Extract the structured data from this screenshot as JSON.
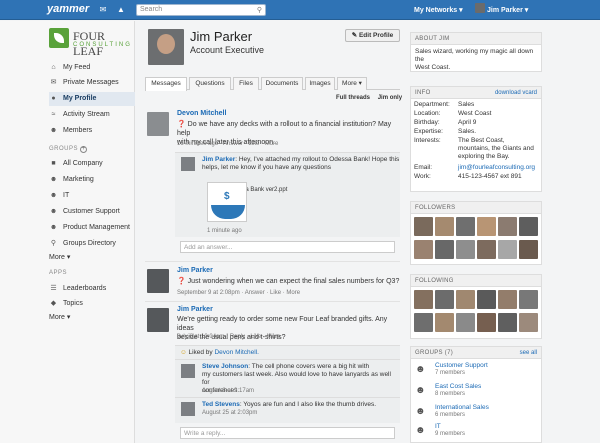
{
  "topbar": {
    "logo": "yammer",
    "search_placeholder": "Search",
    "networks_label": "My Networks ▾",
    "user_label": "Jim Parker ▾"
  },
  "brand": {
    "line1": "FOUR LEAF",
    "line2": "CONSULTING"
  },
  "nav": {
    "items": [
      {
        "label": "My Feed",
        "icon": "home-icon"
      },
      {
        "label": "Private Messages",
        "icon": "mail-icon"
      },
      {
        "label": "My Profile",
        "icon": "user-icon"
      },
      {
        "label": "Activity Stream",
        "icon": "activity-icon"
      },
      {
        "label": "Members",
        "icon": "members-icon"
      }
    ],
    "groups_heading": "GROUPS",
    "groups": [
      {
        "label": "All Company"
      },
      {
        "label": "Marketing"
      },
      {
        "label": "IT"
      },
      {
        "label": "Customer Support"
      },
      {
        "label": "Product Management"
      },
      {
        "label": "Groups Directory"
      }
    ],
    "groups_more": "More ▾",
    "apps_heading": "APPS",
    "apps": [
      {
        "label": "Leaderboards"
      },
      {
        "label": "Topics"
      }
    ],
    "apps_more": "More ▾"
  },
  "profile": {
    "name": "Jim Parker",
    "title": "Account Executive",
    "edit_label": "Edit Profile"
  },
  "tabs": [
    "Messages",
    "Questions",
    "Files",
    "Documents",
    "Images",
    "More ▾"
  ],
  "thread_toggle": {
    "full": "Full threads",
    "only": "Jim only"
  },
  "posts": [
    {
      "author": "Devon Mitchell",
      "text_line1": "Do we have any decks with a rollout to a financial institution? May help",
      "text_line2": "with my call later this afternoon.",
      "meta": "16 minutes ago · Answer · Like · More",
      "reply": {
        "author": "Jim Parker",
        "text_line1": ": Hey, I've attached my rollout to Odessa Bank! Hope this",
        "text_line2": "helps, let me know if you have any questions",
        "file": "Odessa Bank ver2.ppt",
        "time": "1 minute ago"
      },
      "input": "Add an answer..."
    },
    {
      "author": "Jim Parker",
      "text": "Just wondering when we can expect the final sales numbers for Q3?",
      "meta": "September 9 at 2:08pm · Answer · Like · More"
    },
    {
      "author": "Jim Parker",
      "text_line1": "We're getting ready to order some new Four Leaf branded gifts. Any ideas",
      "text_line2": "beside the usual pens and t-shirts?",
      "meta": "July 6 at 10:04am · Reply · Like · More",
      "liked_by_prefix": "Liked by ",
      "liked_by": "Devon Mitchell.",
      "replies": [
        {
          "author": "Steve Johnson",
          "text_line1": ": The cell phone covers were a big hit with",
          "text_line2": "my customers last week. Also would love to have lanyards as well for",
          "text_line3": "conferences.",
          "time": "August 8 at 9:17am"
        },
        {
          "author": "Ted Stevens",
          "text_line1": ": Yoyos are fun and I also like the thumb drives.",
          "time": "August 25 at 2:03pm"
        }
      ],
      "input": "Write a reply..."
    }
  ],
  "about": {
    "heading": "ABOUT JIM",
    "text_line1": "Sales wizard, working my magic all down the",
    "text_line2": "West Coast."
  },
  "info": {
    "heading": "INFO",
    "download": "download vcard",
    "rows": [
      {
        "k": "Department:",
        "v": "Sales"
      },
      {
        "k": "Location:",
        "v": "West Coast"
      },
      {
        "k": "Birthday:",
        "v": "April 9"
      },
      {
        "k": "Expertise:",
        "v": "Sales."
      },
      {
        "k": "Interests:",
        "v": "The Best Coast, mountains, the Giants and exploring the Bay."
      },
      {
        "k": "Email:",
        "v": "jim@fourleafconsulting.org"
      },
      {
        "k": "Work:",
        "v": "415-123-4567 ext 891"
      }
    ]
  },
  "followers": {
    "heading": "FOLLOWERS"
  },
  "following": {
    "heading": "FOLLOWING"
  },
  "groups_panel": {
    "heading": "GROUPS (7)",
    "see_all": "see all",
    "items": [
      {
        "name": "Customer Support",
        "members": "7 members"
      },
      {
        "name": "East Cost Sales",
        "members": "8 members"
      },
      {
        "name": "International Sales",
        "members": "6 members"
      },
      {
        "name": "IT",
        "members": "9 members"
      }
    ]
  },
  "colors": {
    "topbar": "#2f73b5",
    "link": "#1b6ab5",
    "brand_green": "#59a23a"
  }
}
